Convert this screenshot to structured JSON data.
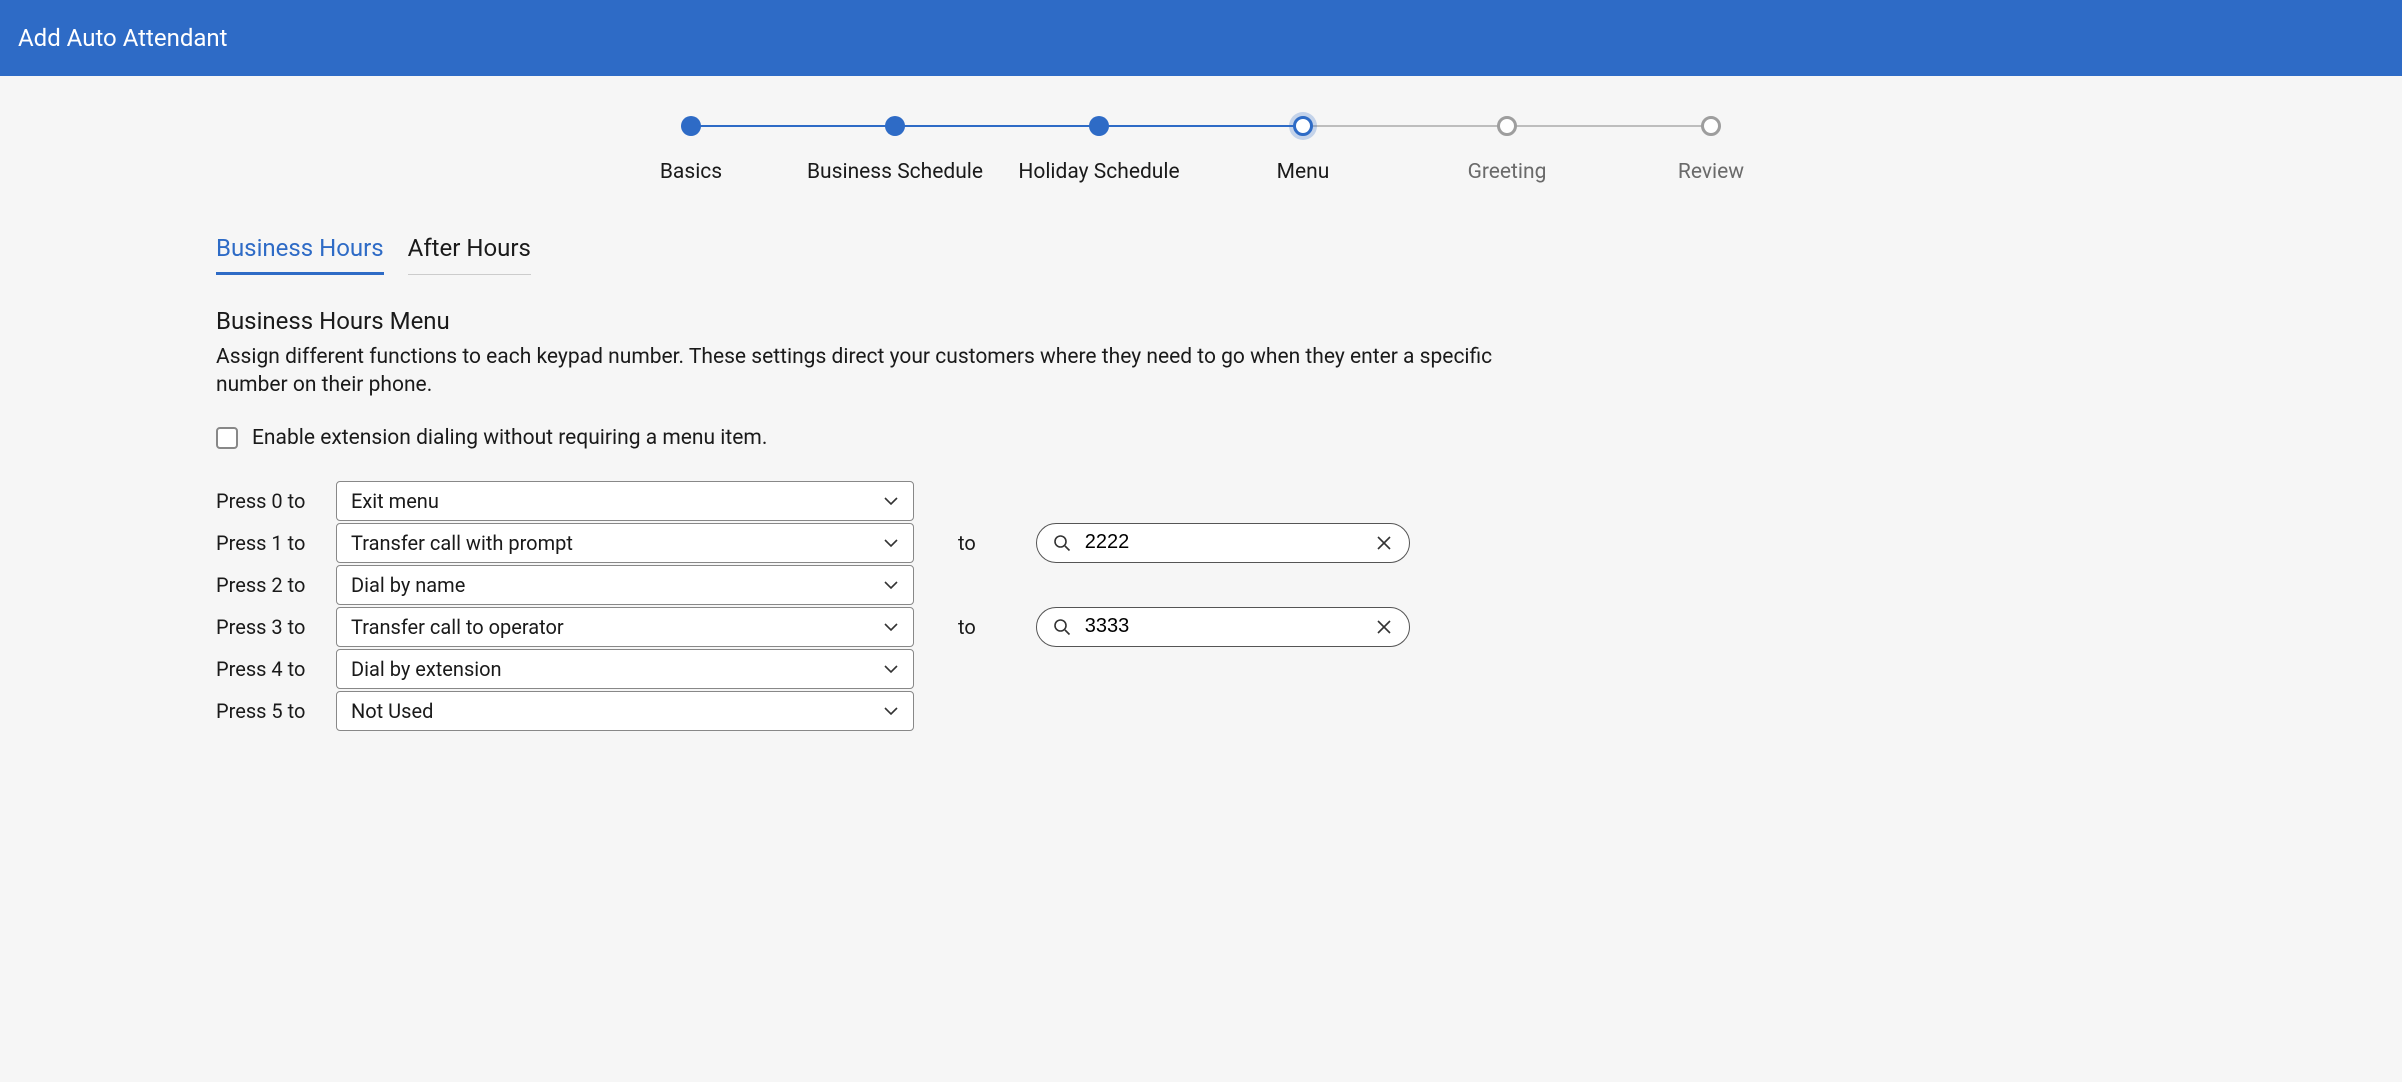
{
  "header": {
    "title": "Add Auto Attendant"
  },
  "stepper": {
    "steps": [
      {
        "label": "Basics",
        "state": "done"
      },
      {
        "label": "Business Schedule",
        "state": "done"
      },
      {
        "label": "Holiday Schedule",
        "state": "done"
      },
      {
        "label": "Menu",
        "state": "current"
      },
      {
        "label": "Greeting",
        "state": "future"
      },
      {
        "label": "Review",
        "state": "future"
      }
    ]
  },
  "tabs": {
    "items": [
      {
        "label": "Business Hours",
        "active": true
      },
      {
        "label": "After Hours",
        "active": false
      }
    ]
  },
  "section": {
    "title": "Business Hours Menu",
    "description": "Assign different functions to each keypad number. These settings direct your customers where they need to go when they enter a specific number on their phone."
  },
  "extension_checkbox": {
    "checked": false,
    "label": "Enable extension dialing without requiring a menu item."
  },
  "labels": {
    "to": "to"
  },
  "keys": [
    {
      "label": "Press 0 to",
      "action": "Exit menu",
      "has_transfer": false
    },
    {
      "label": "Press 1 to",
      "action": "Transfer call with prompt",
      "has_transfer": true,
      "transfer_value": "2222"
    },
    {
      "label": "Press 2 to",
      "action": "Dial by name",
      "has_transfer": false
    },
    {
      "label": "Press 3 to",
      "action": "Transfer call to operator",
      "has_transfer": true,
      "transfer_value": "3333"
    },
    {
      "label": "Press 4 to",
      "action": "Dial by extension",
      "has_transfer": false
    },
    {
      "label": "Press 5 to",
      "action": "Not Used",
      "has_transfer": false
    }
  ]
}
